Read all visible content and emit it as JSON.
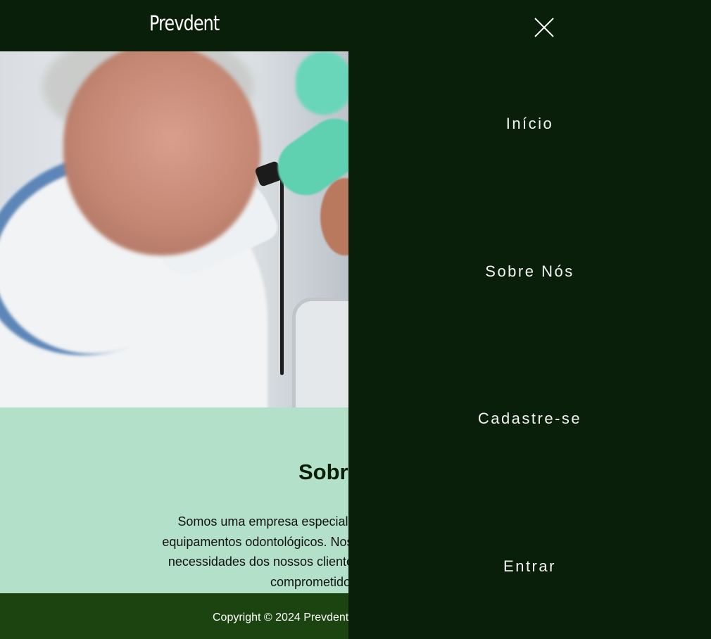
{
  "header": {
    "brand": "Prevdent"
  },
  "hero": {
    "image_alt": "dentist-photo"
  },
  "about": {
    "title": "Sobre Nós",
    "lines": [
      "Somos uma empresa especializada no desenvolvimento de",
      "equipamentos odontológicos. Nosso objetivo é fornecer soluções",
      "necessidades dos nossos clientes. Contamos com uma equipe",
      "comprometidos em ajudar."
    ]
  },
  "footer": {
    "copyright": "Copyright © 2024 Prevdent"
  },
  "drawer": {
    "close_icon": "close-icon",
    "items": [
      {
        "label": "Início"
      },
      {
        "label": "Sobre Nós"
      },
      {
        "label": "Cadastre-se"
      },
      {
        "label": "Entrar"
      }
    ]
  },
  "colors": {
    "dark_green": "#0a1f0a",
    "footer_green": "#1b4410",
    "mint": "#b3e0c9"
  }
}
